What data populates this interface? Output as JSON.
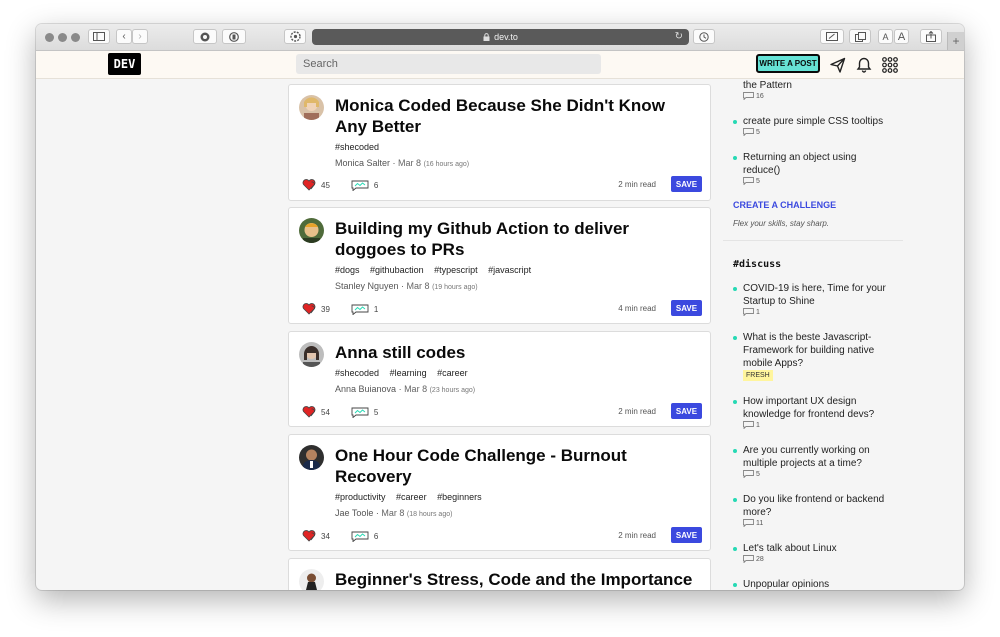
{
  "browser": {
    "url": "dev.to",
    "font_small": "A",
    "font_large": "A",
    "new_tab": "+"
  },
  "header": {
    "logo": "DEV",
    "search_placeholder": "Search",
    "write_post": "WRITE A POST"
  },
  "posts": [
    {
      "title": "Monica Coded Because She Didn't Know Any Better",
      "tags": [
        "#shecoded"
      ],
      "author": "Monica Salter",
      "date": "Mar 8",
      "ago": "(16 hours ago)",
      "reactions": "45",
      "comments": "6",
      "read_time": "2 min read",
      "save": "SAVE"
    },
    {
      "title": "Building my Github Action to deliver doggoes to PRs",
      "tags": [
        "#dogs",
        "#githubaction",
        "#typescript",
        "#javascript"
      ],
      "author": "Stanley Nguyen",
      "date": "Mar 8",
      "ago": "(19 hours ago)",
      "reactions": "39",
      "comments": "1",
      "read_time": "4 min read",
      "save": "SAVE"
    },
    {
      "title": "Anna still codes",
      "tags": [
        "#shecoded",
        "#learning",
        "#career"
      ],
      "author": "Anna Buianova",
      "date": "Mar 8",
      "ago": "(23 hours ago)",
      "reactions": "54",
      "comments": "5",
      "read_time": "2 min read",
      "save": "SAVE"
    },
    {
      "title": "One Hour Code Challenge - Burnout Recovery",
      "tags": [
        "#productivity",
        "#career",
        "#beginners"
      ],
      "author": "Jae Toole",
      "date": "Mar 8",
      "ago": "(18 hours ago)",
      "reactions": "34",
      "comments": "6",
      "read_time": "2 min read",
      "save": "SAVE"
    },
    {
      "title": "Beginner's Stress, Code and the Importance"
    }
  ],
  "sidebar": {
    "challenge_items": [
      {
        "title": "the Pattern",
        "count": "16"
      },
      {
        "title": "create pure simple CSS tooltips",
        "count": "5"
      },
      {
        "title": "Returning an object using reduce()",
        "count": "5"
      }
    ],
    "create_challenge": "CREATE A CHALLENGE",
    "challenge_tagline": "Flex your skills, stay sharp.",
    "discuss_heading": "#discuss",
    "discuss_items": [
      {
        "title": "COVID-19 is here, Time for your Startup to Shine",
        "count": "1"
      },
      {
        "title": "What is the beste Javascript-Framework for building native mobile Apps?",
        "badge": "FRESH"
      },
      {
        "title": "How important UX design knowledge for frontend devs?",
        "count": "1"
      },
      {
        "title": "Are you currently working on multiple projects at a time?",
        "count": "5"
      },
      {
        "title": "Do you like frontend or backend more?",
        "count": "11"
      },
      {
        "title": "Let's talk about Linux",
        "count": "28"
      },
      {
        "title": "Unpopular opinions"
      }
    ]
  },
  "colors": {
    "accent": "#3b49df",
    "write_btn": "#66e2d5",
    "bullet": "#26d9b4",
    "fresh_badge": "#fff59d"
  }
}
